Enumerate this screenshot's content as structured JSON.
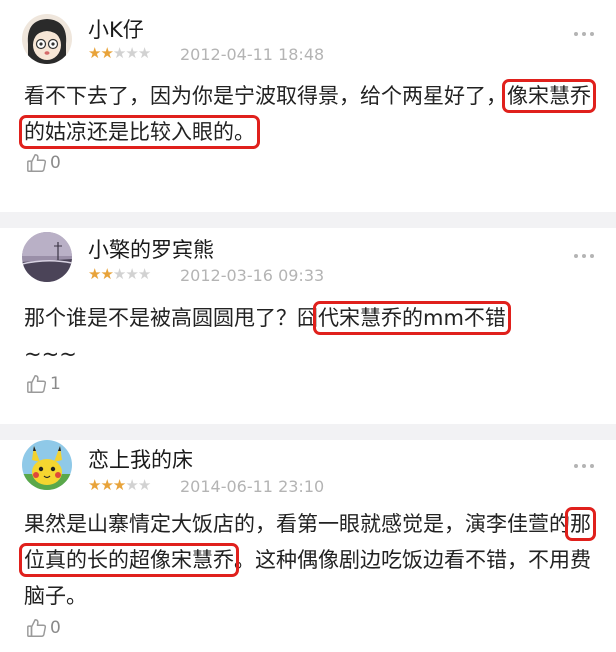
{
  "comments": [
    {
      "username": "小K仔",
      "rating": 2,
      "max_rating": 5,
      "timestamp": "2012-04-11 18:48",
      "text_plain": "看不下去了，因为你是宁波取得景，给个两星好了，",
      "text_highlight": "像宋慧乔的姑凉还是比较入眼的。",
      "text_after": "",
      "like_count": "0",
      "avatar_icon": "cartoon-girl-avatar"
    },
    {
      "username": "小檠的罗宾熊",
      "rating": 2,
      "max_rating": 5,
      "timestamp": "2012-03-16 09:33",
      "text_plain": "那个谁是不是被高圆圆甩了？囧",
      "text_highlight": "代宋慧乔的mm不错",
      "text_after": "~~~",
      "like_count": "1",
      "avatar_icon": "landscape-photo-avatar"
    },
    {
      "username": "恋上我的床",
      "rating": 3,
      "max_rating": 5,
      "timestamp": "2014-06-11 23:10",
      "text_plain": "果然是山寨情定大饭店的，看第一眼就感觉是，演李佳萱的",
      "text_highlight": "那位真的长的超像宋慧乔",
      "text_after": "。这种偶像剧边吃饭边看不错，不用费脑子。",
      "like_count": "0",
      "avatar_icon": "pikachu-avatar"
    }
  ],
  "colors": {
    "star_on": "#e8a33a",
    "star_off": "#d2d2d2",
    "highlight_box": "#e0201c",
    "separator": "#f2f2f4"
  }
}
